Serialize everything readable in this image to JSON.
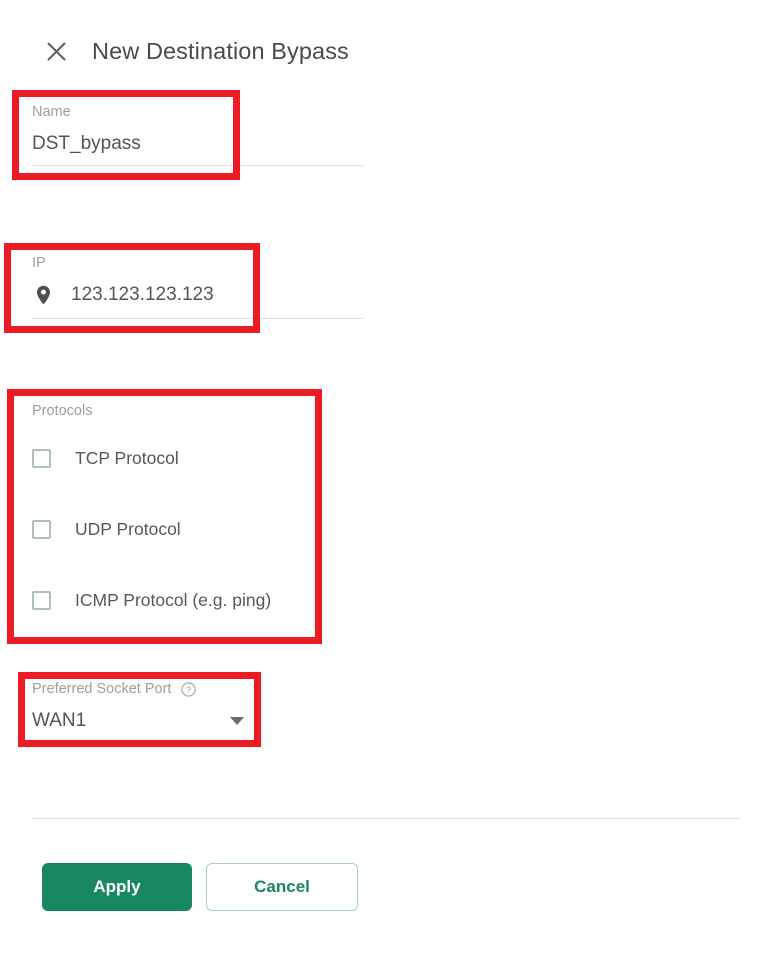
{
  "dialog": {
    "title": "New Destination Bypass",
    "close_icon": "close-icon"
  },
  "fields": {
    "name": {
      "label": "Name",
      "value": "DST_bypass"
    },
    "ip": {
      "label": "IP",
      "value": "123.123.123.123",
      "icon": "location-pin-icon"
    },
    "protocols": {
      "label": "Protocols",
      "items": [
        {
          "label": "TCP Protocol",
          "checked": false
        },
        {
          "label": "UDP Protocol",
          "checked": false
        },
        {
          "label": "ICMP Protocol (e.g. ping)",
          "checked": false
        }
      ]
    },
    "socket_port": {
      "label": "Preferred Socket Port",
      "help_icon": "help-circle-icon",
      "value": "WAN1",
      "caret_icon": "chevron-down-icon"
    }
  },
  "actions": {
    "apply_label": "Apply",
    "cancel_label": "Cancel"
  },
  "colors": {
    "accent_green": "#1a8763",
    "cancel_border": "#a8d2c3",
    "annotation_red": "#ed1c24",
    "label_grey": "#9e9e9e",
    "value_grey": "#545454",
    "checkbox_border": "#aebfc0",
    "divider": "#dedede"
  }
}
